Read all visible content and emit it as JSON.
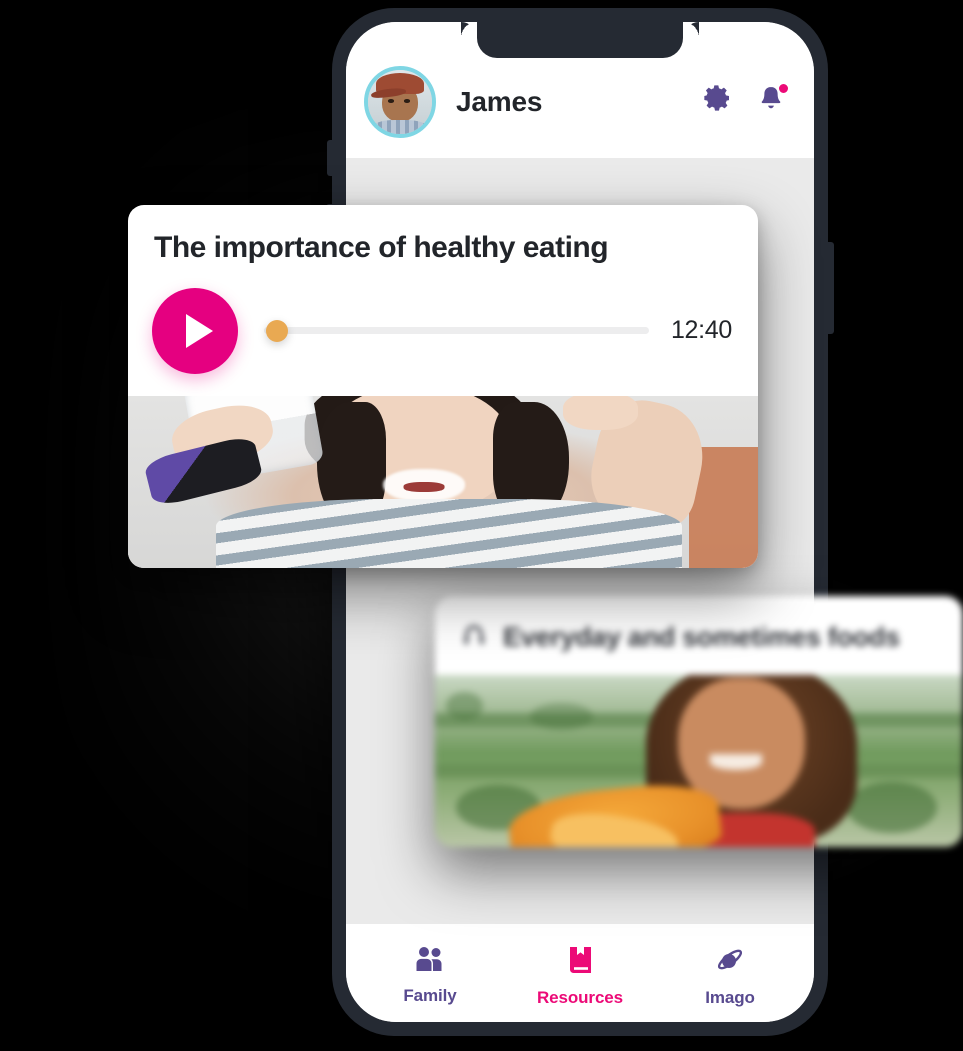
{
  "app": {
    "header": {
      "user_name": "James",
      "avatar_name": "user-avatar",
      "settings_icon": "gear-icon",
      "notifications_icon": "bell-icon",
      "notification_badge_color": "#EC0A77",
      "avatar_ring_color": "#7FD6E4"
    },
    "cards": {
      "video": {
        "title": "The importance of healthy eating",
        "play_icon": "play-icon",
        "play_button_color": "#E50080",
        "progress_thumb_color": "#E9A952",
        "progress_percent": 0,
        "duration": "12:40",
        "thumbnail_alt": "girl-drinking-milk-flexing-arm"
      },
      "audio": {
        "title": "Everyday and sometimes foods",
        "leading_icon": "headphones-icon",
        "thumbnail_alt": "girl-outdoors-with-food"
      }
    },
    "bottom_nav": {
      "items": [
        {
          "label": "Family",
          "icon": "people-icon",
          "color": "#584A8F",
          "active": false
        },
        {
          "label": "Resources",
          "icon": "bookmark-icon",
          "color": "#EC0A77",
          "active": true
        },
        {
          "label": "Imago",
          "icon": "planet-icon",
          "color": "#584A8F",
          "active": false
        }
      ]
    }
  }
}
